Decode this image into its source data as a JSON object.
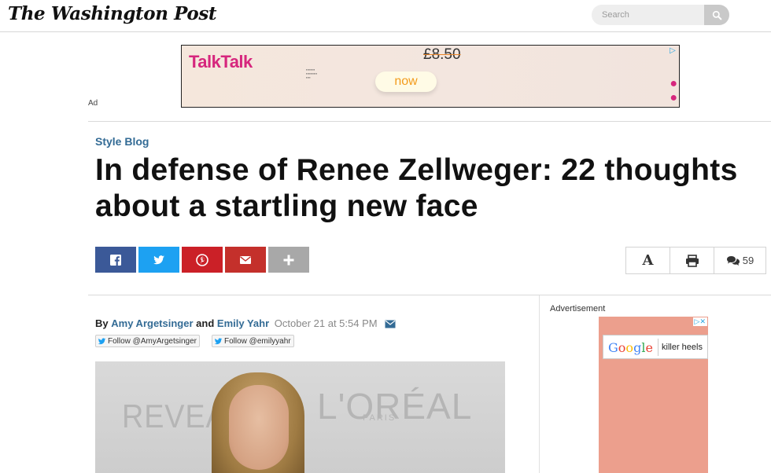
{
  "header": {
    "logo": "The Washington Post",
    "search_placeholder": "Search"
  },
  "top_ad": {
    "brand": "TalkTalk",
    "old_price": "£8.50",
    "offer": "now",
    "label": "Ad"
  },
  "article": {
    "kicker": "Style Blog",
    "headline": "In defense of Renee Zellweger: 22 thoughts about a startling new face",
    "share": [
      {
        "name": "facebook",
        "icon": "facebook-icon",
        "color": "#3b5998"
      },
      {
        "name": "twitter",
        "icon": "twitter-icon",
        "color": "#1da1f2"
      },
      {
        "name": "pinterest",
        "icon": "pinterest-icon",
        "color": "#cb2027"
      },
      {
        "name": "email",
        "icon": "email-icon",
        "color": "#c4302b"
      },
      {
        "name": "more",
        "icon": "plus-icon",
        "color": "#a8a8a8"
      }
    ],
    "tools": {
      "font_label": "A",
      "comments_count": "59"
    },
    "byline": {
      "prefix": "By",
      "author1": "Amy Argetsinger",
      "conj": "and",
      "author2": "Emily Yahr",
      "timestamp": "October 21 at 5:54 PM"
    },
    "follow": [
      {
        "label": "Follow @AmyArgetsinger"
      },
      {
        "label": "Follow @emilyyahr"
      }
    ],
    "photo": {
      "text_left": "REVEA",
      "text_brand": "L'ORÉAL",
      "text_sub": "PARIS"
    }
  },
  "side_ad": {
    "label": "Advertisement",
    "google": "Google",
    "query": "killer heels"
  }
}
